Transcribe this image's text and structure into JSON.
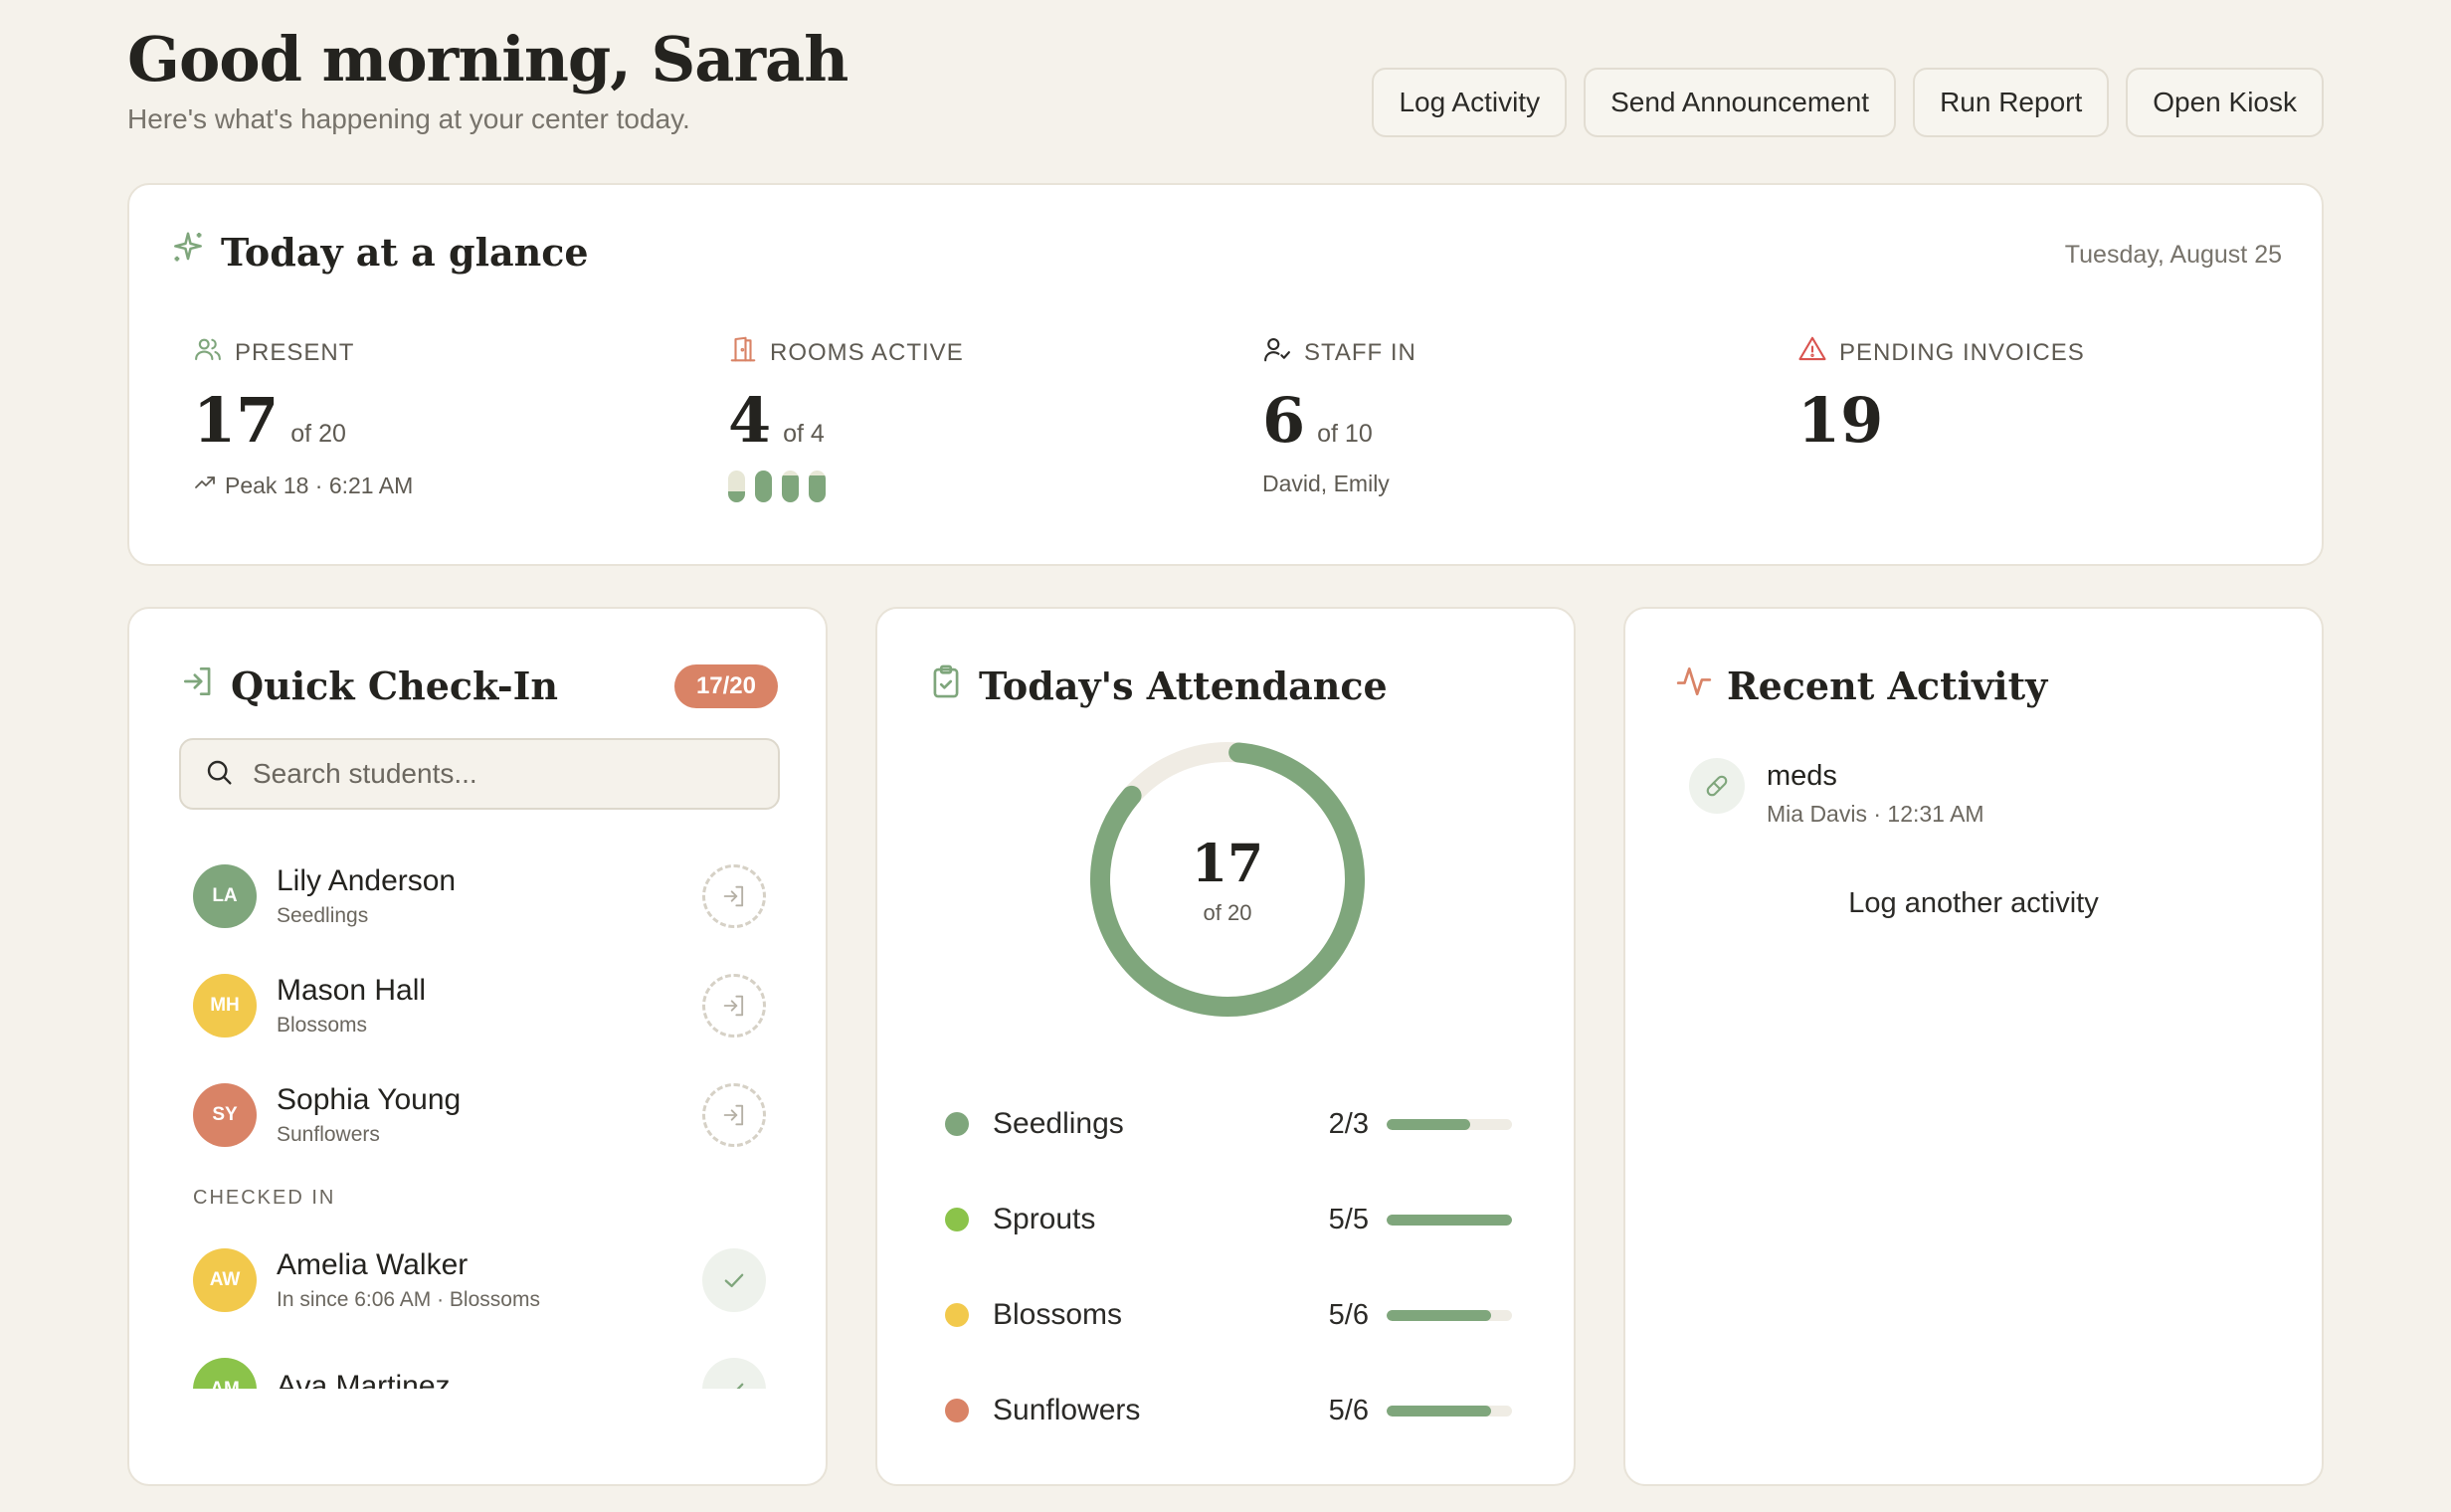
{
  "header": {
    "greeting": "Good morning, Sarah",
    "subtitle": "Here's what's happening at your center today.",
    "actions": [
      "Log Activity",
      "Send Announcement",
      "Run Report",
      "Open Kiosk"
    ]
  },
  "glance": {
    "title": "Today at a glance",
    "date": "Tuesday, August 25",
    "present": {
      "label": "PRESENT",
      "value": "17",
      "of": "of 20",
      "note": "Peak 18 · 6:21 AM"
    },
    "rooms": {
      "label": "ROOMS ACTIVE",
      "value": "4",
      "of": "of 4",
      "room_fill": [
        0.35,
        1.0,
        0.85,
        0.85
      ]
    },
    "staff": {
      "label": "STAFF IN",
      "value": "6",
      "of": "of 10",
      "note": "David, Emily"
    },
    "invoices": {
      "label": "PENDING INVOICES",
      "value": "19"
    }
  },
  "checkin": {
    "title": "Quick Check-In",
    "badge": "17/20",
    "search_placeholder": "Search students...",
    "pending": [
      {
        "initials": "LA",
        "name": "Lily Anderson",
        "room": "Seedlings",
        "color": "#7fa67c"
      },
      {
        "initials": "MH",
        "name": "Mason Hall",
        "room": "Blossoms",
        "color": "#f2c94c"
      },
      {
        "initials": "SY",
        "name": "Sophia Young",
        "room": "Sunflowers",
        "color": "#d98366"
      }
    ],
    "checked_in_label": "CHECKED IN",
    "checked_in": [
      {
        "initials": "AW",
        "name": "Amelia Walker",
        "sub": "In since 6:06 AM · Blossoms",
        "color": "#f2c94c"
      },
      {
        "initials": "AM",
        "name": "Ava Martinez",
        "sub": "",
        "color": "#8bc34a"
      }
    ]
  },
  "attendance": {
    "title": "Today's Attendance",
    "present": 17,
    "total": 20,
    "present_label": "17",
    "of_label": "of 20",
    "rooms": [
      {
        "name": "Seedlings",
        "count": "2/3",
        "fraction": 0.667,
        "color": "#7fa67c"
      },
      {
        "name": "Sprouts",
        "count": "5/5",
        "fraction": 1.0,
        "color": "#8bc34a"
      },
      {
        "name": "Blossoms",
        "count": "5/6",
        "fraction": 0.833,
        "color": "#f2c94c"
      },
      {
        "name": "Sunflowers",
        "count": "5/6",
        "fraction": 0.833,
        "color": "#d98366"
      }
    ]
  },
  "activity": {
    "title": "Recent Activity",
    "items": [
      {
        "title": "meds",
        "sub": "Mia Davis · 12:31 AM",
        "icon": "pill-icon"
      }
    ],
    "log_another": "Log another activity"
  },
  "colors": {
    "accent": "#7fa67c",
    "warning": "#d98366",
    "background": "#f5f2eb"
  }
}
